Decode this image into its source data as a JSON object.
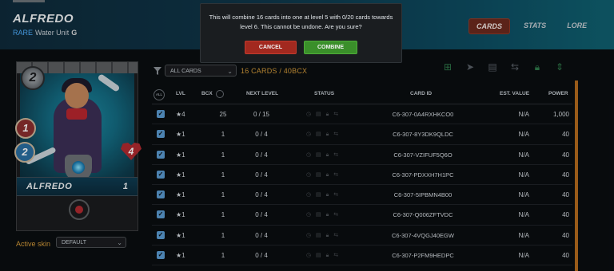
{
  "header": {
    "unit_name": "ALFREDO",
    "rarity": "RARE",
    "element_type": "Water Unit",
    "edition_badge": "G",
    "tabs": [
      {
        "label": "CARDS",
        "active": true
      },
      {
        "label": "STATS",
        "active": false
      },
      {
        "label": "LORE",
        "active": false
      }
    ]
  },
  "card": {
    "mana": "2",
    "attack": "1",
    "speed": "2",
    "health": "4",
    "name": "ALFREDO",
    "level": "1",
    "ability_icon": "ability-icon"
  },
  "skin": {
    "label": "Active skin",
    "selected": "DEFAULT"
  },
  "toolbar": {
    "filter_selected": "ALL CARDS",
    "count_text": "16 CARDS / 40BCX",
    "actions": [
      "combine-icon",
      "send-icon",
      "market-icon",
      "transfer-icon",
      "lock-icon",
      "sort-icon"
    ]
  },
  "table": {
    "all_label": "ALL",
    "headers": {
      "lvl": "LVL",
      "bcx": "BCX",
      "next_level": "NEXT LEVEL",
      "status": "STATUS",
      "card_id": "CARD ID",
      "est_value": "EST. VALUE",
      "power": "POWER"
    },
    "rows": [
      {
        "checked": true,
        "lvl": "★4",
        "bcx": "25",
        "next": "0 / 15",
        "card_id": "C6-307-0A4RXHKCO0",
        "value": "N/A",
        "power": "1,000"
      },
      {
        "checked": true,
        "lvl": "★1",
        "bcx": "1",
        "next": "0 / 4",
        "card_id": "C6-307-8Y3DK9QLDC",
        "value": "N/A",
        "power": "40"
      },
      {
        "checked": true,
        "lvl": "★1",
        "bcx": "1",
        "next": "0 / 4",
        "card_id": "C6-307-VZIFUF5Q6O",
        "value": "N/A",
        "power": "40"
      },
      {
        "checked": true,
        "lvl": "★1",
        "bcx": "1",
        "next": "0 / 4",
        "card_id": "C6-307-PDXXH7H1PC",
        "value": "N/A",
        "power": "40"
      },
      {
        "checked": true,
        "lvl": "★1",
        "bcx": "1",
        "next": "0 / 4",
        "card_id": "C6-307-5IPBMN4B00",
        "value": "N/A",
        "power": "40"
      },
      {
        "checked": true,
        "lvl": "★1",
        "bcx": "1",
        "next": "0 / 4",
        "card_id": "C6-307-Q006ZFTVDC",
        "value": "N/A",
        "power": "40"
      },
      {
        "checked": true,
        "lvl": "★1",
        "bcx": "1",
        "next": "0 / 4",
        "card_id": "C6-307-4VQGJ40EGW",
        "value": "N/A",
        "power": "40"
      },
      {
        "checked": true,
        "lvl": "★1",
        "bcx": "1",
        "next": "0 / 4",
        "card_id": "C6-307-P2FM9HEDPC",
        "value": "N/A",
        "power": "40"
      }
    ]
  },
  "modal": {
    "message": "This will combine 16 cards into one at level 5 with 0/20 cards towards level 6. This cannot be undone. Are you sure?",
    "cancel_label": "CANCEL",
    "confirm_label": "COMBINE"
  },
  "colors": {
    "accent_orange": "#d49b3a",
    "cancel_red": "#a2291f",
    "combine_green": "#3a8f2a",
    "checkbox_blue": "#5a9bd0"
  }
}
